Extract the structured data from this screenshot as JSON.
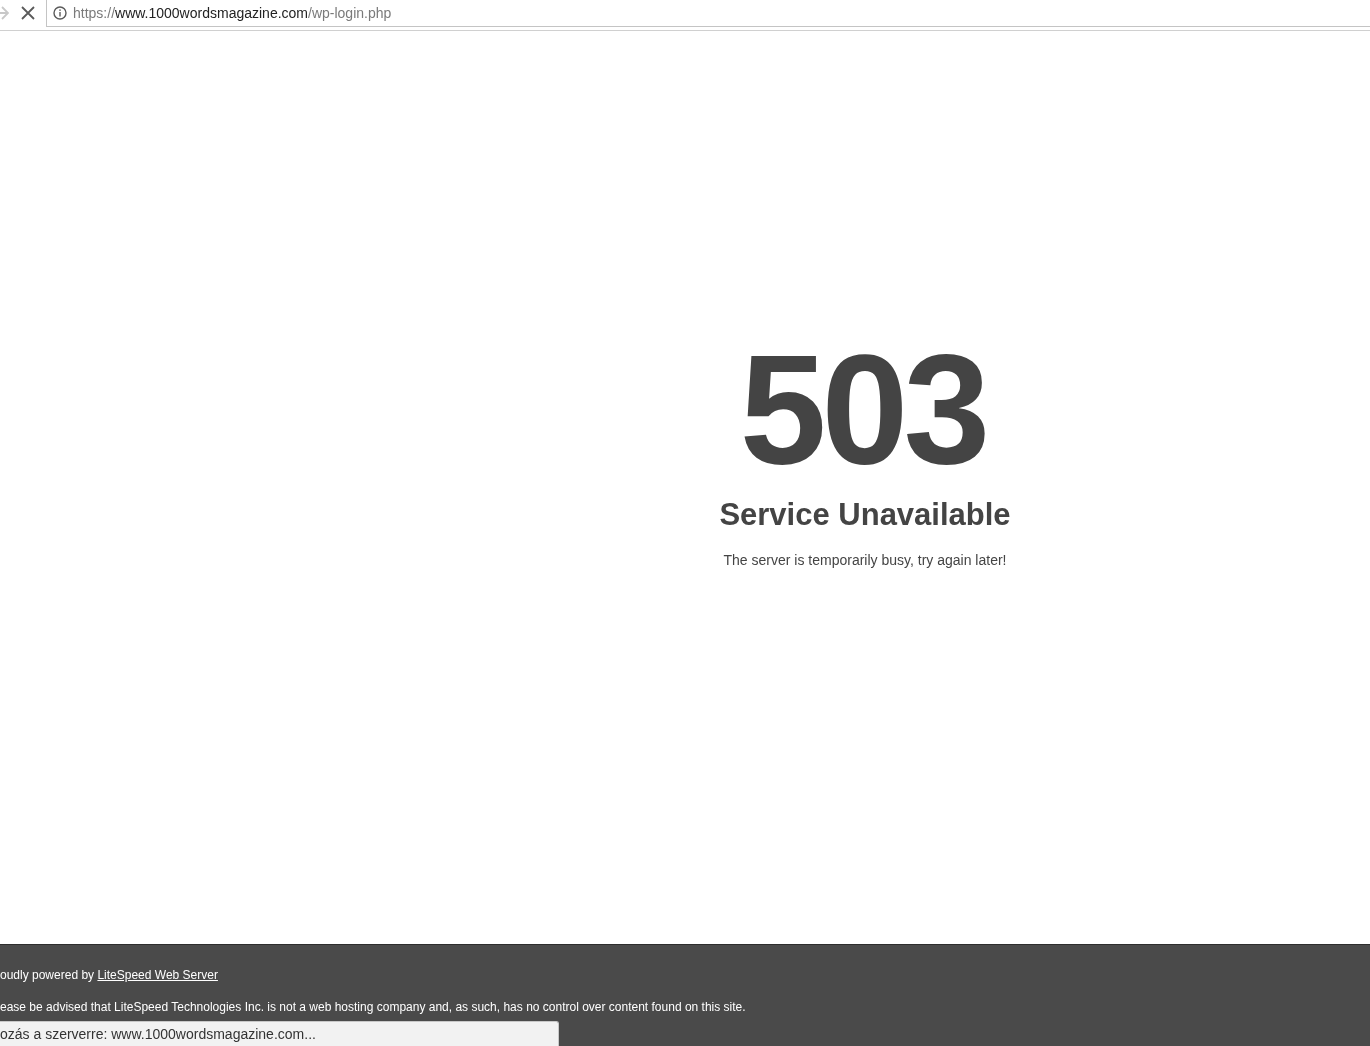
{
  "browser": {
    "forward": {
      "disabled": true
    },
    "url": {
      "scheme": "https://",
      "host": "www.1000wordsmagazine.com",
      "path": "/wp-login.php"
    }
  },
  "page": {
    "code": "503",
    "title": "Service Unavailable",
    "message": "The server is temporarily busy, try again later!"
  },
  "footer": {
    "powered_by": {
      "text": "oudly powered by",
      "link": "LiteSpeed Web Server"
    },
    "notice": "ease be advised that LiteSpeed Technologies Inc. is not a web hosting company and, as such, has no control over content found on this site."
  },
  "status_bubble": {
    "text": "ozás a szerverre: www.1000wordsmagazine.com..."
  }
}
